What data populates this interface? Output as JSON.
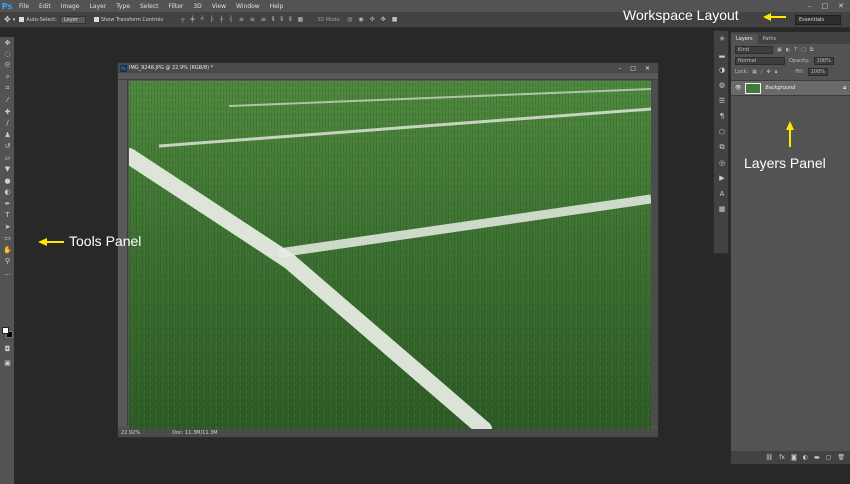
{
  "app": {
    "logo": "Ps"
  },
  "menu": [
    "File",
    "Edit",
    "Image",
    "Layer",
    "Type",
    "Select",
    "Filter",
    "3D",
    "View",
    "Window",
    "Help"
  ],
  "window_controls": [
    "–",
    "□",
    "✕"
  ],
  "options_bar": {
    "auto_select_label": "Auto-Select:",
    "auto_select_value": "Layer",
    "transform_label": "Show Transform Controls",
    "mode_3d_label": "3D Mode:",
    "workspace_value": "Essentials"
  },
  "document": {
    "tab_title": "IMG_9248.JPG @ 22.9% (RGB/8) *",
    "zoom": "22.92%",
    "doc_size": "Doc: 11.3M/11.3M"
  },
  "layers_panel": {
    "tabs": [
      "Layers",
      "Paths"
    ],
    "kind_label": "Kind",
    "blend_mode": "Normal",
    "opacity_label": "Opacity:",
    "opacity_value": "100%",
    "lock_label": "Lock:",
    "fill_label": "Fill:",
    "fill_value": "100%",
    "layer_name": "Background"
  },
  "annotations": {
    "workspace": "Workspace Layout",
    "tools": "Tools Panel",
    "layers": "Layers Panel",
    "arrow_color": "#ffe800"
  }
}
